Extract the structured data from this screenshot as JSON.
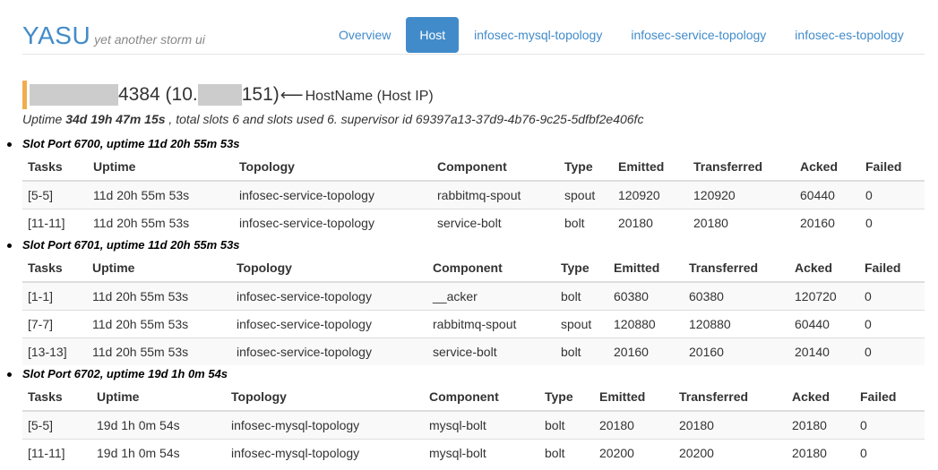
{
  "brand": {
    "title": "YASU",
    "subtitle": "yet another storm ui"
  },
  "nav": {
    "items": [
      {
        "label": "Overview",
        "active": false
      },
      {
        "label": "Host",
        "active": true
      },
      {
        "label": "infosec-mysql-topology",
        "active": false
      },
      {
        "label": "infosec-service-topology",
        "active": false
      },
      {
        "label": "infosec-es-topology",
        "active": false
      }
    ]
  },
  "host": {
    "part1": "4384 (10.",
    "part2": "151)",
    "annotation": "HostName (Host IP)"
  },
  "summary": {
    "uptime_prefix": "Uptime ",
    "uptime": "34d 19h 47m 15s",
    "rest": " , total slots 6 and slots used 6. supervisor id 69397a13-37d9-4b76-9c25-5dfbf2e406fc"
  },
  "columns": [
    "Tasks",
    "Uptime",
    "Topology",
    "Component",
    "Type",
    "Emitted",
    "Transferred",
    "Acked",
    "Failed"
  ],
  "slots": [
    {
      "title": "Slot Port 6700, uptime 11d 20h 55m 53s",
      "rows": [
        [
          "[5-5]",
          "11d 20h 55m 53s",
          "infosec-service-topology",
          "rabbitmq-spout",
          "spout",
          "120920",
          "120920",
          "60440",
          "0"
        ],
        [
          "[11-11]",
          "11d 20h 55m 53s",
          "infosec-service-topology",
          "service-bolt",
          "bolt",
          "20180",
          "20180",
          "20160",
          "0"
        ]
      ]
    },
    {
      "title": "Slot Port 6701, uptime 11d 20h 55m 53s",
      "rows": [
        [
          "[1-1]",
          "11d 20h 55m 53s",
          "infosec-service-topology",
          "__acker",
          "bolt",
          "60380",
          "60380",
          "120720",
          "0"
        ],
        [
          "[7-7]",
          "11d 20h 55m 53s",
          "infosec-service-topology",
          "rabbitmq-spout",
          "spout",
          "120880",
          "120880",
          "60440",
          "0"
        ],
        [
          "[13-13]",
          "11d 20h 55m 53s",
          "infosec-service-topology",
          "service-bolt",
          "bolt",
          "20160",
          "20160",
          "20140",
          "0"
        ]
      ]
    },
    {
      "title": "Slot Port 6702, uptime 19d 1h 0m 54s",
      "rows": [
        [
          "[5-5]",
          "19d 1h 0m 54s",
          "infosec-mysql-topology",
          "mysql-bolt",
          "bolt",
          "20180",
          "20180",
          "20180",
          "0"
        ],
        [
          "[11-11]",
          "19d 1h 0m 54s",
          "infosec-mysql-topology",
          "mysql-bolt",
          "bolt",
          "20200",
          "20200",
          "20180",
          "0"
        ]
      ]
    }
  ]
}
